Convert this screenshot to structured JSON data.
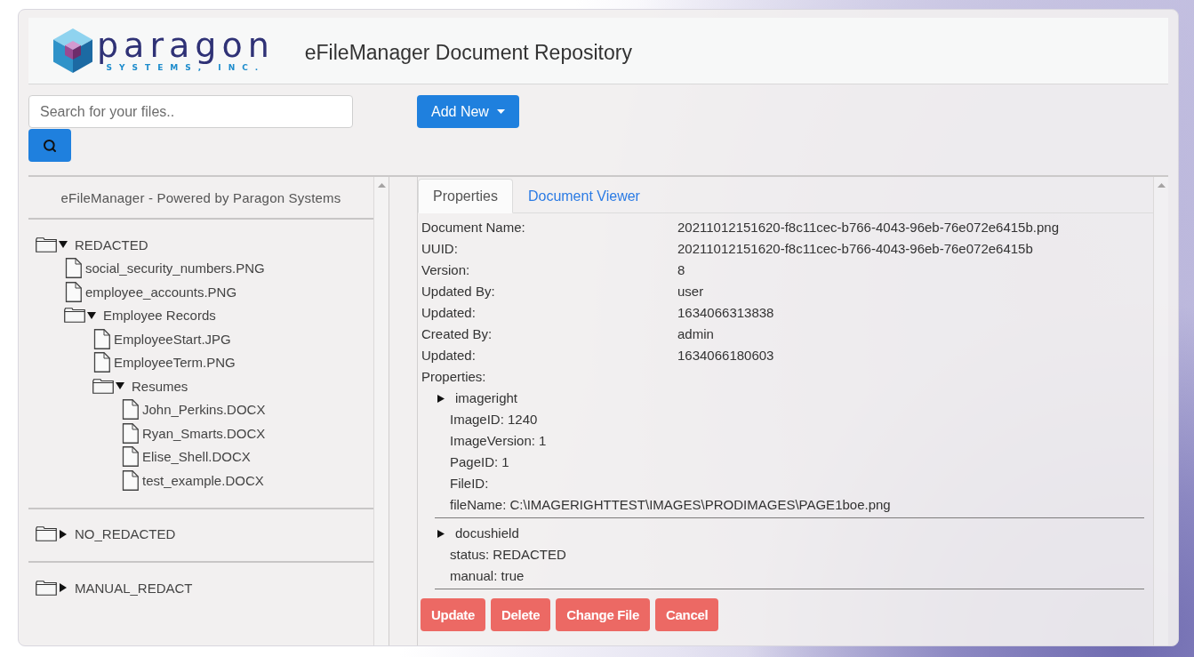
{
  "header": {
    "logo": {
      "wordmark": "paragon",
      "tagline": "SYSTEMS, INC."
    },
    "title": "eFileManager Document Repository"
  },
  "toolbar": {
    "search": {
      "placeholder": "Search for your files.."
    },
    "add_button": {
      "label": "Add New"
    }
  },
  "sidebar": {
    "title": "eFileManager - Powered by Paragon Systems",
    "tree": [
      {
        "kind": "folder",
        "name": "REDACTED",
        "expanded": true,
        "children": [
          {
            "kind": "file",
            "name": "social_security_numbers.PNG"
          },
          {
            "kind": "file",
            "name": "employee_accounts.PNG"
          },
          {
            "kind": "folder",
            "name": "Employee Records",
            "expanded": true,
            "children": [
              {
                "kind": "file",
                "name": "EmployeeStart.JPG"
              },
              {
                "kind": "file",
                "name": "EmployeeTerm.PNG"
              },
              {
                "kind": "folder",
                "name": "Resumes",
                "expanded": true,
                "children": [
                  {
                    "kind": "file",
                    "name": "John_Perkins.DOCX"
                  },
                  {
                    "kind": "file",
                    "name": "Ryan_Smarts.DOCX"
                  },
                  {
                    "kind": "file",
                    "name": "Elise_Shell.DOCX"
                  },
                  {
                    "kind": "file",
                    "name": "test_example.DOCX"
                  }
                ]
              }
            ]
          }
        ]
      },
      {
        "kind": "folder",
        "name": "NO_REDACTED",
        "expanded": false
      },
      {
        "kind": "folder",
        "name": "MANUAL_REDACT",
        "expanded": false
      }
    ]
  },
  "details": {
    "tabs": [
      {
        "label": "Properties",
        "selected": true
      },
      {
        "label": "Document Viewer",
        "selected": false
      }
    ],
    "fields": [
      {
        "label": "Document Name:",
        "value": "20211012151620-f8c11cec-b766-4043-96eb-76e072e6415b.png"
      },
      {
        "label": "UUID:",
        "value": "20211012151620-f8c11cec-b766-4043-96eb-76e072e6415b"
      },
      {
        "label": "Version:",
        "value": "8"
      },
      {
        "label": "Updated By:",
        "value": "user"
      },
      {
        "label": "Updated:",
        "value": "1634066313838"
      },
      {
        "label": "Created By:",
        "value": "admin"
      },
      {
        "label": "Updated:",
        "value": "1634066180603"
      }
    ],
    "properties_label": "Properties:",
    "groups": [
      {
        "name": "imageright",
        "entries": [
          "ImageID: 1240",
          "ImageVersion: 1",
          "PageID: 1",
          "FileID:",
          "fileName: C:\\IMAGERIGHTTEST\\IMAGES\\PRODIMAGES\\PAGE1boe.png"
        ]
      },
      {
        "name": "docushield",
        "entries": [
          "status: REDACTED",
          "manual: true"
        ]
      }
    ],
    "buttons": [
      {
        "label": "Update"
      },
      {
        "label": "Delete"
      },
      {
        "label": "Change File"
      },
      {
        "label": "Cancel"
      }
    ]
  }
}
